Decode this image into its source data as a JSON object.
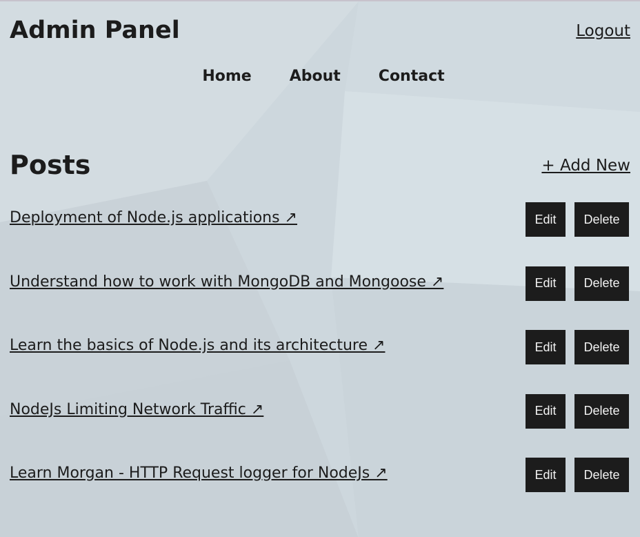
{
  "header": {
    "title": "Admin Panel",
    "logout_label": "Logout"
  },
  "nav": {
    "items": [
      {
        "label": "Home"
      },
      {
        "label": "About"
      },
      {
        "label": "Contact"
      }
    ]
  },
  "posts": {
    "heading": "Posts",
    "add_new_label": "+ Add New",
    "edit_label": "Edit",
    "delete_label": "Delete",
    "items": [
      {
        "title": "Deployment of Node.js applications ↗"
      },
      {
        "title": "Understand how to work with MongoDB and Mongoose ↗"
      },
      {
        "title": "Learn the basics of Node.js and its architecture ↗"
      },
      {
        "title": "NodeJs Limiting Network Traffic ↗"
      },
      {
        "title": "Learn Morgan - HTTP Request logger for NodeJs ↗"
      }
    ]
  }
}
